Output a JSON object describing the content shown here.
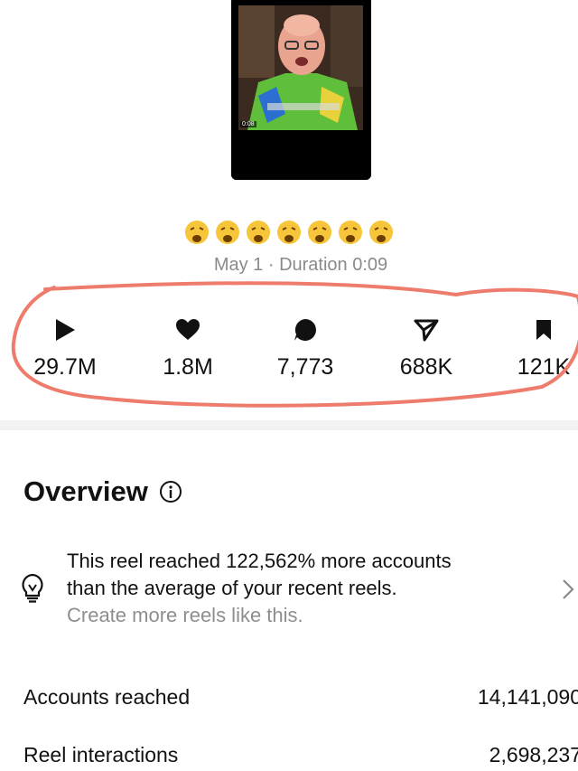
{
  "reel": {
    "timestamp": "0:08",
    "emojis": [
      "😩",
      "😩",
      "😩",
      "😩",
      "😩",
      "😩",
      "😩"
    ],
    "date_duration": "May 1 · Duration 0:09"
  },
  "stats": [
    {
      "icon": "play-icon",
      "value": "29.7M"
    },
    {
      "icon": "heart-icon",
      "value": "1.8M"
    },
    {
      "icon": "comment-icon",
      "value": "7,773"
    },
    {
      "icon": "share-icon",
      "value": "688K"
    },
    {
      "icon": "bookmark-icon",
      "value": "121K"
    }
  ],
  "overview": {
    "title": "Overview",
    "insight_line1": "This reel reached 122,562% more accounts",
    "insight_line2": "than the average of your recent reels.",
    "insight_link": "Create more reels like this."
  },
  "metrics": [
    {
      "label": "Accounts reached",
      "value": "14,141,090"
    },
    {
      "label": "Reel interactions",
      "value": "2,698,237"
    }
  ],
  "colors": {
    "annotation": "#ee7c6d",
    "muted": "#8a8a8a",
    "divider": "#f2f2f2"
  }
}
